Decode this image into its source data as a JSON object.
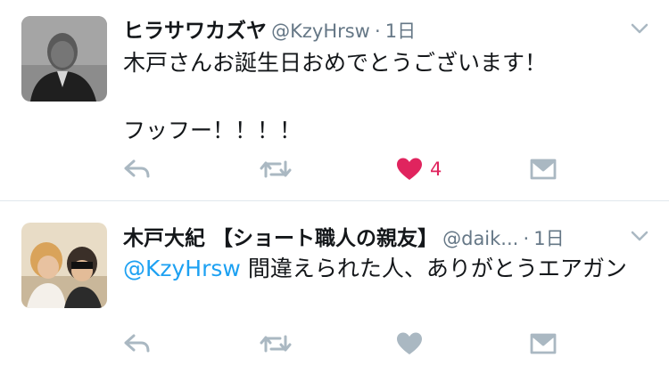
{
  "tweets": [
    {
      "name": "ヒラサワカズヤ",
      "handle": "@KzyHrsw",
      "separator": "·",
      "time": "1日",
      "text": "木戸さんお誕生日おめでとうございます！\n\nフッフー！！！！",
      "liked": true,
      "like_count": "4",
      "like_color": "#e0245e"
    },
    {
      "name": "木戸大紀 【ショート職人の親友】",
      "handle": "@daik...",
      "separator": "·",
      "time": "1日",
      "mention": "@KzyHrsw",
      "text": " 間違えられた人、ありがとうエアガン",
      "liked": false,
      "like_count": ""
    }
  ],
  "icons": [
    "reply-icon",
    "retweet-icon",
    "heart-icon",
    "dm-icon",
    "chevron-down-icon"
  ],
  "colors": {
    "accent": "#1da1f2",
    "like": "#e0245e",
    "icon": "#aab8c2",
    "secondary": "#657786"
  }
}
